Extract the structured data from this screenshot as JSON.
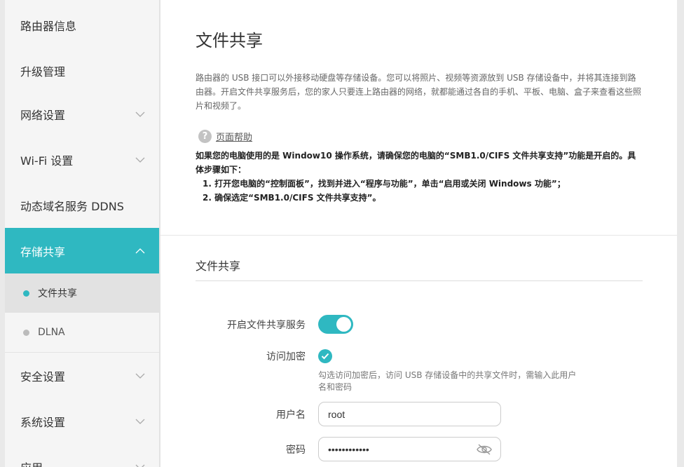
{
  "sidebar": {
    "items": [
      {
        "label": "路由器信息"
      },
      {
        "label": "升级管理"
      },
      {
        "label": "网络设置"
      },
      {
        "label": "Wi-Fi 设置"
      },
      {
        "label": "动态域名服务 DDNS"
      },
      {
        "label": "存储共享"
      },
      {
        "label": "安全设置"
      },
      {
        "label": "系统设置"
      },
      {
        "label": "应用"
      }
    ],
    "sub_items": [
      {
        "label": "文件共享"
      },
      {
        "label": "DLNA"
      }
    ]
  },
  "main": {
    "title": "文件共享",
    "description": "路由器的 USB 接口可以外接移动硬盘等存储设备。您可以将照片、视频等资源放到 USB 存储设备中，并将其连接到路由器。开启文件共享服务后，您的家人只要连上路由器的网络，就都能通过各自的手机、平板、电脑、盒子来查看这些照片和视频了。",
    "help_label": "页面帮助",
    "note_line1": "如果您的电脑使用的是 Window10 操作系统，请确保您的电脑的“SMB1.0/CIFS 文件共享支持”功能是开启的。具体步骤如下：",
    "note_step1": "1. 打开您电脑的“控制面板”，找到并进入“程序与功能”，单击“启用或关闭 Windows 功能”；",
    "note_step2": "2. 确保选定“SMB1.0/CIFS 文件共享支持”。",
    "section_title": "文件共享",
    "enable_label": "开启文件共享服务",
    "enable_on": true,
    "encrypt_label": "访问加密",
    "encrypt_checked": true,
    "encrypt_hint": "勾选访问加密后，访问 USB 存储设备中的共享文件时，需输入此用户名和密码",
    "username_label": "用户名",
    "username_value": "root",
    "password_label": "密码",
    "password_value": "••••••••••••"
  },
  "colors": {
    "accent": "#2fb8c1"
  },
  "icons": [
    "chevron-down-icon",
    "chevron-up-icon",
    "help-icon",
    "check-icon",
    "eye-off-icon"
  ]
}
